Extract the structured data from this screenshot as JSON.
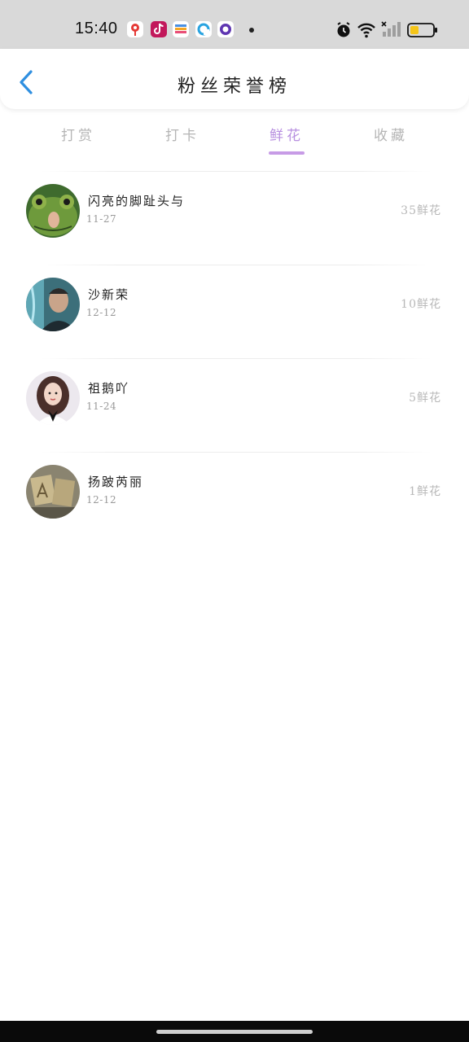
{
  "status_bar": {
    "time": "15:40",
    "apps": [
      "map-pin-app-icon",
      "tiktok-app-icon",
      "wallet-app-icon",
      "browser-app-icon",
      "messenger-app-icon"
    ],
    "system_icons": [
      "alarm-icon",
      "wifi-icon",
      "cellular-signal-icon",
      "battery-icon"
    ],
    "battery_level": 0.4,
    "battery_color": "#f5c518"
  },
  "header": {
    "title": "粉丝荣誉榜",
    "back_color": "#2f8fe0"
  },
  "tabs": [
    {
      "label": "打赏",
      "active": false
    },
    {
      "label": "打卡",
      "active": false
    },
    {
      "label": "鲜花",
      "active": true
    },
    {
      "label": "收藏",
      "active": false
    }
  ],
  "accent_color": "#c79be6",
  "fans": [
    {
      "name": "闪亮的脚趾头与",
      "date": "11-27",
      "count": "35鲜花",
      "avatar": "frog-mask-avatar"
    },
    {
      "name": "沙新荣",
      "date": "12-12",
      "count": "10鲜花",
      "avatar": "man-portrait-avatar"
    },
    {
      "name": "祖鹅吖",
      "date": "11-24",
      "count": "5鲜花",
      "avatar": "woman-portrait-avatar"
    },
    {
      "name": "扬跛芮丽",
      "date": "12-12",
      "count": "1鲜花",
      "avatar": "letter-cards-avatar"
    }
  ]
}
